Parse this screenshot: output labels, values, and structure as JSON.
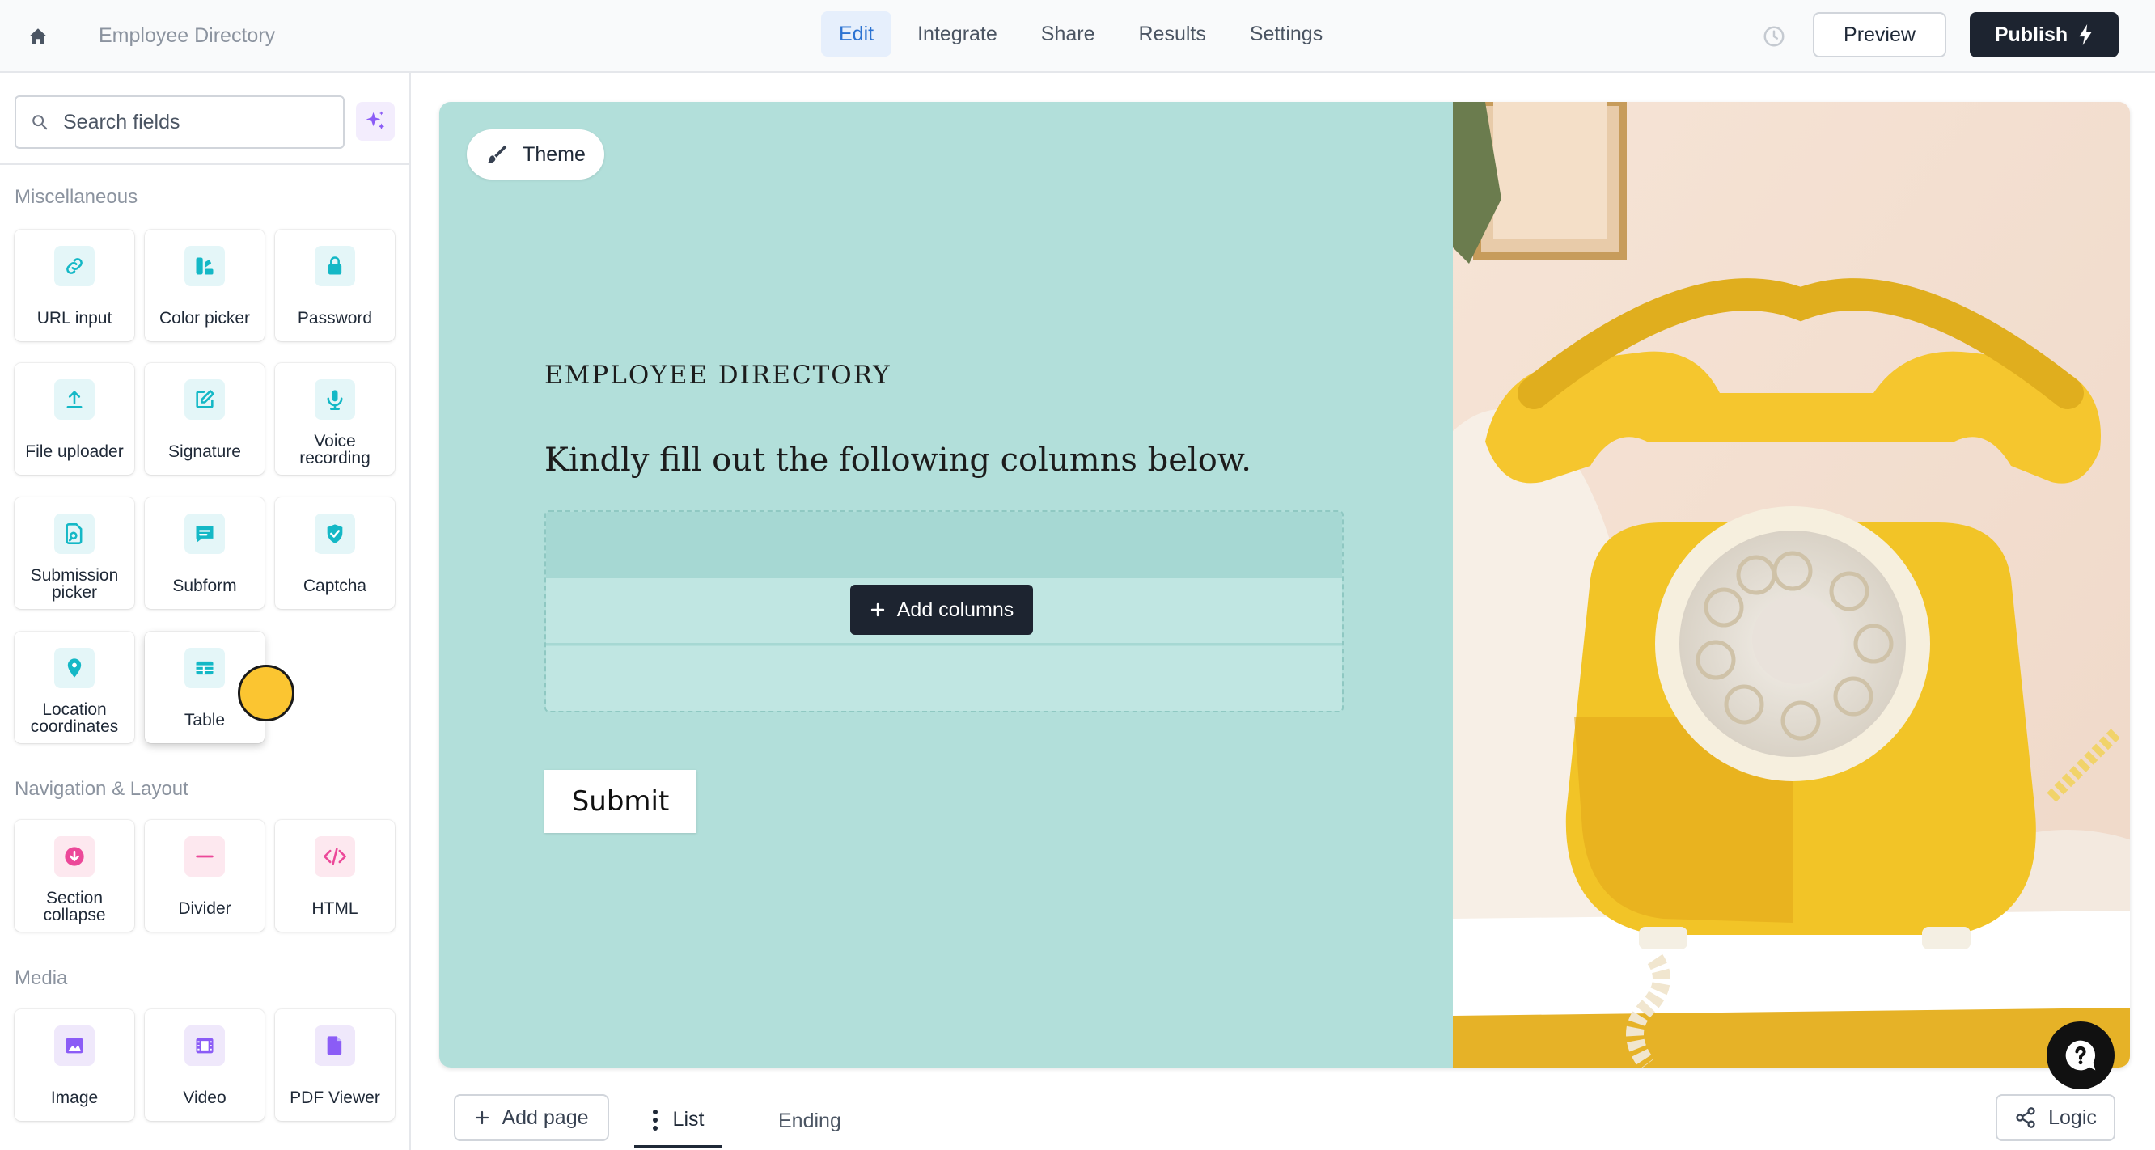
{
  "header": {
    "form_title": "Employee Directory",
    "tabs": [
      {
        "label": "Edit",
        "active": true
      },
      {
        "label": "Integrate",
        "active": false
      },
      {
        "label": "Share",
        "active": false
      },
      {
        "label": "Results",
        "active": false
      },
      {
        "label": "Settings",
        "active": false
      }
    ],
    "preview_label": "Preview",
    "publish_label": "Publish"
  },
  "sidebar": {
    "search_placeholder": "Search fields",
    "sections": [
      {
        "label": "Miscellaneous",
        "items": [
          {
            "label": "URL input",
            "icon": "link-icon"
          },
          {
            "label": "Color picker",
            "icon": "palette-icon"
          },
          {
            "label": "Password",
            "icon": "lock-icon"
          },
          {
            "label": "File uploader",
            "icon": "upload-icon"
          },
          {
            "label": "Signature",
            "icon": "pencil-square-icon"
          },
          {
            "label": "Voice recording",
            "icon": "microphone-icon"
          },
          {
            "label": "Submission picker",
            "icon": "document-search-icon"
          },
          {
            "label": "Subform",
            "icon": "chat-form-icon"
          },
          {
            "label": "Captcha",
            "icon": "shield-check-icon"
          },
          {
            "label": "Location coordinates",
            "icon": "map-pin-icon"
          },
          {
            "label": "Table",
            "icon": "table-icon"
          }
        ]
      },
      {
        "label": "Navigation & Layout",
        "items": [
          {
            "label": "Section collapse",
            "icon": "chevron-circle-icon"
          },
          {
            "label": "Divider",
            "icon": "minus-icon"
          },
          {
            "label": "HTML",
            "icon": "code-icon"
          }
        ]
      },
      {
        "label": "Media",
        "items": [
          {
            "label": "Image",
            "icon": "image-icon"
          },
          {
            "label": "Video",
            "icon": "film-icon"
          },
          {
            "label": "PDF Viewer",
            "icon": "file-icon"
          }
        ]
      }
    ]
  },
  "canvas": {
    "theme_label": "Theme",
    "form_heading": "EMPLOYEE DIRECTORY",
    "form_description": "Kindly fill out the following columns below.",
    "add_columns_label": "Add columns",
    "submit_label": "Submit",
    "colors": {
      "form_background": "#b2dfda",
      "accent": "#1d2430"
    }
  },
  "footer": {
    "add_page_label": "Add page",
    "list_label": "List",
    "ending_label": "Ending",
    "logic_label": "Logic"
  }
}
